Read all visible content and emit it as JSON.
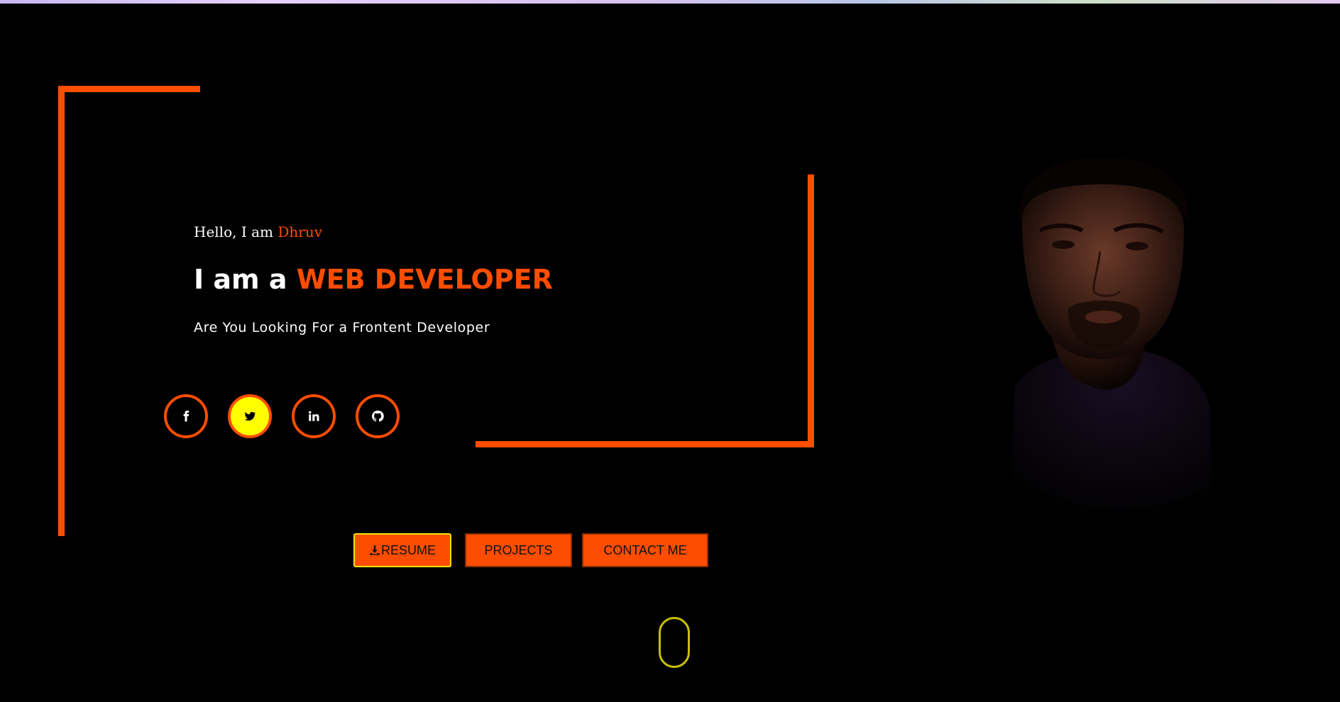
{
  "hero": {
    "greeting_prefix": "Hello, I am ",
    "greeting_name": "Dhruv",
    "headline_prefix": "I am a ",
    "headline_role": "WEB DEVELOPER",
    "subtitle": "Are You Looking For a Frontent Developer"
  },
  "social_links": [
    {
      "icon": "facebook-icon",
      "state": "normal"
    },
    {
      "icon": "twitter-icon",
      "state": "hover"
    },
    {
      "icon": "linkedin-icon",
      "state": "normal"
    },
    {
      "icon": "github-icon",
      "state": "normal"
    }
  ],
  "buttons": {
    "resume_label": "RESUME",
    "projects_label": "PROJECTS",
    "contact_label": "CONTACT ME"
  },
  "colors": {
    "accent": "#ff4d00",
    "hover": "#ffff00",
    "background": "#000000",
    "scroll_indicator": "#c9c000"
  }
}
